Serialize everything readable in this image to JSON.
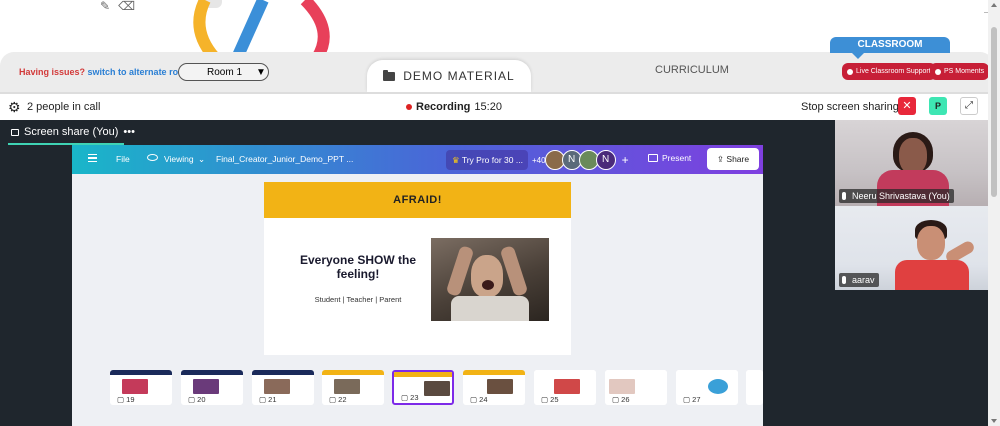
{
  "header": {
    "issues_text": "Having issues?",
    "alternate_link": "switch to alternate room",
    "room_value": "Room 1",
    "demo_material": "DEMO MATERIAL",
    "curriculum": "CURRICULUM",
    "classroom_tab": "CLASSROOM",
    "live_support": "Live Classroom Support",
    "ps_moments": "PS Moments"
  },
  "call": {
    "people": "2 people in call",
    "recording_label": "Recording",
    "recording_time": "15:20",
    "stop_sharing": "Stop screen sharing",
    "p_label": "P",
    "share_tab": "Screen share (You)"
  },
  "canva": {
    "file": "File",
    "viewing": "Viewing",
    "doc_title": "Final_Creator_Junior_Demo_PPT ...",
    "try_pro": "Try Pro for 30 ...",
    "plus_count": "+40",
    "avatar_n1": "N",
    "avatar_n2": "N",
    "present": "Present",
    "share": "Share"
  },
  "slide": {
    "header": "AFRAID!",
    "title": "Everyone SHOW the feeling!",
    "subtitle": "Student | Teacher | Parent"
  },
  "thumbnails": [
    "19",
    "20",
    "21",
    "22",
    "23",
    "24",
    "25",
    "26",
    "27"
  ],
  "participants": [
    {
      "name": "Neeru Shrivastava (You)"
    },
    {
      "name": "aarav"
    }
  ],
  "colors": {
    "accent_red": "#c71f37",
    "classroom_blue": "#3d8fd6",
    "slide_yellow": "#f2b315",
    "canva_purple": "#7d2ae8",
    "share_underline": "#3fd3b4"
  }
}
